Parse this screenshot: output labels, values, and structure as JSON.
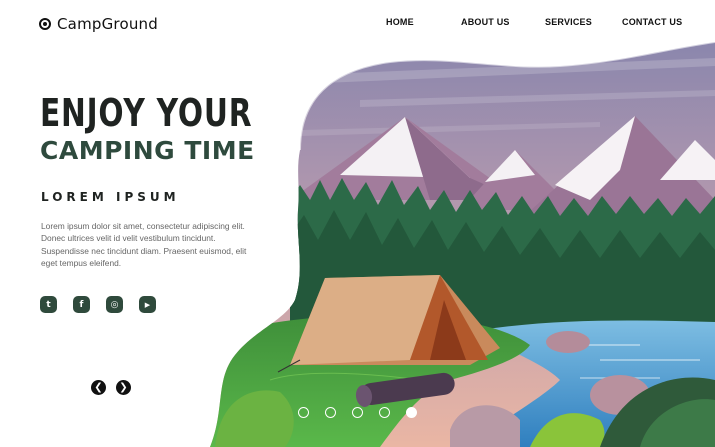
{
  "brand": {
    "name": "CampGround",
    "icon": "target-icon"
  },
  "nav": {
    "items": [
      "HOME",
      "ABOUT US",
      "SERVICES",
      "CONTACT US"
    ]
  },
  "hero": {
    "title_line1": "ENJOY YOUR",
    "title_line2": "CAMPING TIME",
    "subheading": "LOREM IPSUM",
    "body": "Lorem ipsum dolor sit amet, consectetur adipiscing elit. Donec ultrices velit id velit vestibulum tincidunt. Suspendisse nec tincidunt diam. Praesent euismod, elit eget tempus eleifend."
  },
  "social": [
    {
      "icon": "twitter-icon",
      "glyph": "t"
    },
    {
      "icon": "facebook-icon",
      "glyph": "f"
    },
    {
      "icon": "instagram-icon",
      "glyph": "◎"
    },
    {
      "icon": "youtube-icon",
      "glyph": "▶"
    }
  ],
  "slider": {
    "prev_glyph": "❮",
    "next_glyph": "❯",
    "dot_count": 5,
    "active_index": 4
  },
  "colors": {
    "title_dark": "#1f2321",
    "title_green": "#2e4a3d",
    "social_bg": "#2f4a3c",
    "sky_top": "#8a86ad",
    "sky_bottom": "#e8b4a6",
    "mountain": "#a07a9a",
    "forest": "#2f6b48",
    "meadow": "#4aa33f",
    "lake": "#4f9bd0",
    "tent": "#d4a27a"
  }
}
